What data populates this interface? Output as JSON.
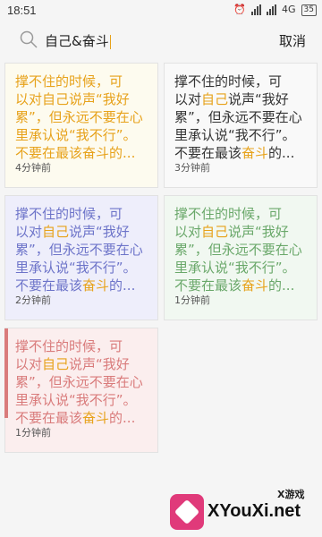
{
  "status_bar": {
    "time": "18:51",
    "network": "4G",
    "battery": "35"
  },
  "search": {
    "query": "自己&奋斗",
    "cancel_label": "取消"
  },
  "notes": [
    {
      "line1": "撑不住的时候，可",
      "line2a": "以对",
      "line2h": "自己",
      "line2b": "说声“我好",
      "line3": "累”，但永远不要在心",
      "line4": "里承认说“我不行”。",
      "line5a": "不要在最该",
      "line5h": "奋斗",
      "line5b": "的...",
      "time": "4分钟前",
      "bg": "#fdfbef",
      "text_color": "#e7a21b"
    },
    {
      "line1": "撑不住的时候，可",
      "line2a": "以对",
      "line2h": "自己",
      "line2b": "说声“我好",
      "line3": "累”，但永远不要在心",
      "line4": "里承认说“我不行”。",
      "line5a": "不要在最该",
      "line5h": "奋斗",
      "line5b": "的...",
      "time": "3分钟前",
      "bg": "#f9f9f9",
      "text_color": "#333333"
    },
    {
      "line1": "撑不住的时候，可",
      "line2a": "以对",
      "line2h": "自己",
      "line2b": "说声“我好",
      "line3": "累”，但永远不要在心",
      "line4": "里承认说“我不行”。",
      "line5a": "不要在最该",
      "line5h": "奋斗",
      "line5b": "的...",
      "time": "2分钟前",
      "bg": "#eeeefb",
      "text_color": "#6d74c9"
    },
    {
      "line1": "撑不住的时候，可",
      "line2a": "以对",
      "line2h": "自己",
      "line2b": "说声“我好",
      "line3": "累”，但永远不要在心",
      "line4": "里承认说“我不行”。",
      "line5a": "不要在最该",
      "line5h": "奋斗",
      "line5b": "的...",
      "time": "1分钟前",
      "bg": "#f1f8f1",
      "text_color": "#6aa86a"
    },
    {
      "line1": "撑不住的时候，可",
      "line2a": "以对",
      "line2h": "自己",
      "line2b": "说声“我好",
      "line3": "累”，但永远不要在心",
      "line4": "里承认说“我不行”。",
      "line5a": "不要在最该",
      "line5h": "奋斗",
      "line5b": "的...",
      "time": "1分钟前",
      "bg": "#fbeeee",
      "text_color": "#d97b7b"
    }
  ],
  "watermark": {
    "small": "X游戏",
    "big": "XYouXi.net"
  }
}
